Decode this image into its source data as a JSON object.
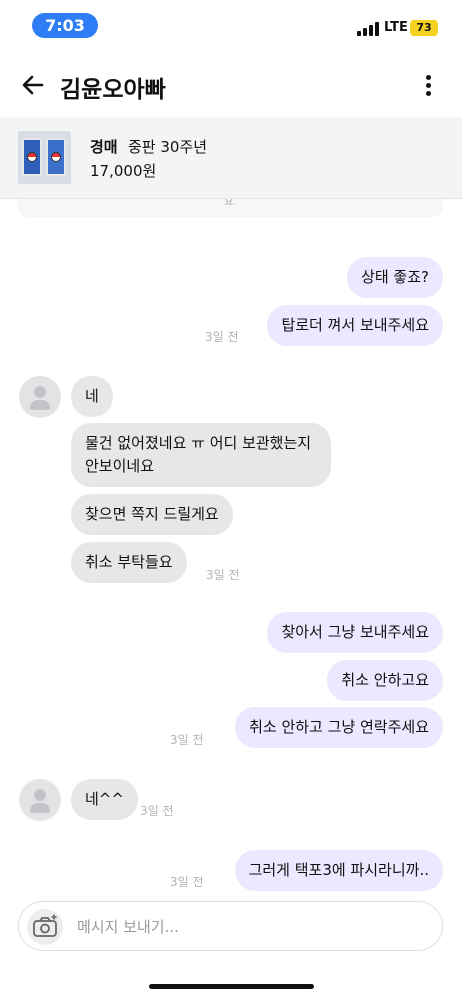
{
  "status_bar": {
    "time": "7:03",
    "network": "LTE",
    "battery": "73"
  },
  "header": {
    "title": "김윤오아빠",
    "back_icon": "arrow-left-icon",
    "more_icon": "more-vertical-icon"
  },
  "product": {
    "tag": "경매",
    "name": "중판 30주년",
    "price": "17,000원"
  },
  "notice_fragment": "요.",
  "messages": [
    {
      "from": "me",
      "text": "상태 좋죠?",
      "time": ""
    },
    {
      "from": "me",
      "text": "탑로더 껴서 보내주세요",
      "time": "3일 전"
    },
    {
      "from": "them",
      "text": "네",
      "time": ""
    },
    {
      "from": "them",
      "text": "물건 없어졌네요 ㅠ 어디 보관했는지 안보이네요",
      "time": ""
    },
    {
      "from": "them",
      "text": "찾으면 쪽지 드릴게요",
      "time": ""
    },
    {
      "from": "them",
      "text": "취소 부탁들요",
      "time": "3일 전"
    },
    {
      "from": "me",
      "text": "찾아서 그냥 보내주세요",
      "time": ""
    },
    {
      "from": "me",
      "text": "취소 안하고요",
      "time": ""
    },
    {
      "from": "me",
      "text": "취소 안하고 그냥 연락주세요",
      "time": "3일 전"
    },
    {
      "from": "them",
      "text": "네^^",
      "time": "3일 전"
    },
    {
      "from": "me",
      "text": "그러게 택포3에 파시라니까..",
      "time": "3일 전"
    }
  ],
  "composer": {
    "placeholder": "메시지 보내기...",
    "value": "",
    "camera_icon": "camera-icon"
  },
  "colors": {
    "time_pill": "#2f7df6",
    "battery": "#f4d21f",
    "my_bubble": "#ebe8ff",
    "their_bubble": "#e7e7ea",
    "timestamp": "#b3b3b8"
  }
}
